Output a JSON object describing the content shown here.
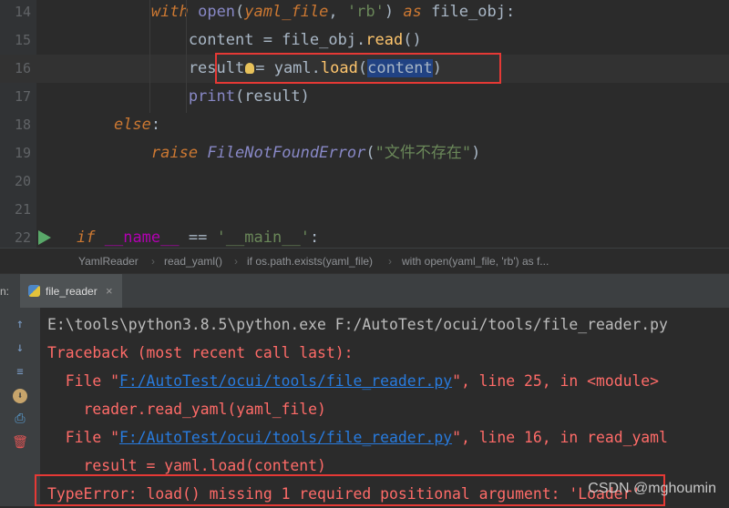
{
  "editor": {
    "lines": [
      {
        "num": "14",
        "segments": [
          {
            "t": "        "
          },
          {
            "t": "with",
            "c": "kw"
          },
          {
            "t": " "
          },
          {
            "t": "open",
            "c": "fn"
          },
          {
            "t": "("
          },
          {
            "t": "yaml_file",
            "c": "kw"
          },
          {
            "t": ", "
          },
          {
            "t": "'rb'",
            "c": "str"
          },
          {
            "t": ") "
          },
          {
            "t": "as",
            "c": "kw"
          },
          {
            "t": " file_obj:"
          }
        ]
      },
      {
        "num": "15",
        "segments": [
          {
            "t": "            content = file_obj."
          },
          {
            "t": "read",
            "c": "meth"
          },
          {
            "t": "()"
          }
        ]
      },
      {
        "num": "16",
        "segments": [
          {
            "t": "            result"
          },
          {
            "t": "",
            "c": "bulb"
          },
          {
            "t": "= yaml."
          },
          {
            "t": "load",
            "c": "meth"
          },
          {
            "t": "("
          },
          {
            "t": "content",
            "c": "sel"
          },
          {
            "t": ")"
          }
        ],
        "current": true
      },
      {
        "num": "17",
        "segments": [
          {
            "t": "            "
          },
          {
            "t": "print",
            "c": "fn"
          },
          {
            "t": "(result)"
          }
        ]
      },
      {
        "num": "18",
        "segments": [
          {
            "t": "    "
          },
          {
            "t": "else",
            "c": "kw"
          },
          {
            "t": ":"
          }
        ]
      },
      {
        "num": "19",
        "segments": [
          {
            "t": "        "
          },
          {
            "t": "raise",
            "c": "kw"
          },
          {
            "t": " "
          },
          {
            "t": "FileNotFoundError",
            "c": "cls"
          },
          {
            "t": "("
          },
          {
            "t": "\"文件不存在\"",
            "c": "str"
          },
          {
            "t": ")"
          }
        ]
      },
      {
        "num": "20",
        "segments": []
      },
      {
        "num": "21",
        "segments": []
      },
      {
        "num": "22",
        "segments": [
          {
            "t": "if",
            "c": "kw"
          },
          {
            "t": " "
          },
          {
            "t": "__name__",
            "c": "dunder"
          },
          {
            "t": " == "
          },
          {
            "t": "'__main__'",
            "c": "str"
          },
          {
            "t": ":"
          }
        ],
        "run": true
      }
    ]
  },
  "breadcrumb": [
    "YamlReader",
    "read_yaml()",
    "if os.path.exists(yaml_file)",
    "with open(yaml_file, 'rb') as f..."
  ],
  "run_panel": {
    "label": "n:",
    "tab_label": "file_reader",
    "tab_close": "×"
  },
  "console": {
    "lines": [
      [
        {
          "t": "E:\\tools\\python3.8.5\\python.exe F:/AutoTest/ocui/tools/file_reader.py"
        }
      ],
      [
        {
          "t": "Traceback (most recent call last):",
          "c": "err"
        }
      ],
      [
        {
          "t": "  File \"",
          "c": "err"
        },
        {
          "t": "F:/AutoTest/ocui/tools/file_reader.py",
          "c": "link"
        },
        {
          "t": "\", line 25, in <module>",
          "c": "err"
        }
      ],
      [
        {
          "t": "    reader.read_yaml(yaml_file)",
          "c": "err"
        }
      ],
      [
        {
          "t": "  File \"",
          "c": "err"
        },
        {
          "t": "F:/AutoTest/ocui/tools/file_reader.py",
          "c": "link"
        },
        {
          "t": "\", line 16, in read_yaml",
          "c": "err"
        }
      ],
      [
        {
          "t": "    result = yaml.load(content)",
          "c": "err"
        }
      ],
      [
        {
          "t": "TypeError: load() missing 1 required positional argument: 'Loader'",
          "c": "err"
        }
      ]
    ]
  },
  "watermark": "CSDN @mghoumin",
  "colors": {
    "highlight_box": "#e53935",
    "error_text": "#ff6b68",
    "link": "#287bde"
  }
}
